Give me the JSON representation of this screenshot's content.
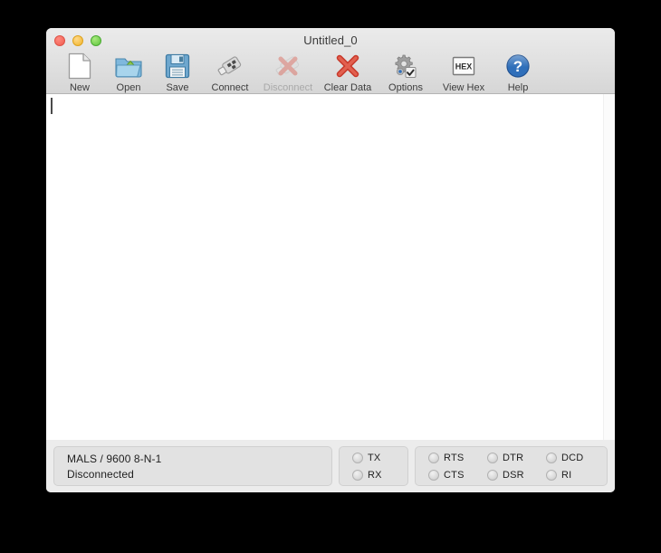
{
  "window": {
    "title": "Untitled_0",
    "traffic_lights": [
      {
        "name": "close",
        "color": "#f05c4e"
      },
      {
        "name": "minimize",
        "color": "#f0b428"
      },
      {
        "name": "zoom",
        "color": "#5cc33c"
      }
    ]
  },
  "toolbar": {
    "items": [
      {
        "label": "New",
        "icon": "new-document-icon",
        "enabled": true
      },
      {
        "label": "Open",
        "icon": "open-folder-icon",
        "enabled": true
      },
      {
        "label": "Save",
        "icon": "floppy-disk-icon",
        "enabled": true
      },
      {
        "label": "Connect",
        "icon": "usb-plug-icon",
        "enabled": true
      },
      {
        "label": "Disconnect",
        "icon": "red-x-icon",
        "enabled": false
      },
      {
        "label": "Clear Data",
        "icon": "red-x-bold-icon",
        "enabled": true
      },
      {
        "label": "Options",
        "icon": "gears-icon",
        "enabled": true
      },
      {
        "label": "View Hex",
        "icon": "hex-box-icon",
        "enabled": true
      },
      {
        "label": "Help",
        "icon": "question-mark-icon",
        "enabled": true
      }
    ],
    "hex_icon_text": "HEX"
  },
  "content": {
    "text": "",
    "caret_visible": true
  },
  "statusbar": {
    "line1": "MALS / 9600 8-N-1",
    "line2": "Disconnected",
    "signal_group_1": [
      {
        "label": "TX",
        "on": false
      },
      {
        "label": "RX",
        "on": false
      }
    ],
    "signal_group_2": [
      {
        "label": "RTS",
        "on": false
      },
      {
        "label": "CTS",
        "on": false
      },
      {
        "label": "DTR",
        "on": false
      },
      {
        "label": "DSR",
        "on": false
      },
      {
        "label": "DCD",
        "on": false
      },
      {
        "label": "RI",
        "on": false
      }
    ]
  },
  "colors": {
    "desktop_background": "#000000",
    "window_chrome": "#ececec",
    "toolbar_top": "#ebebeb",
    "toolbar_bottom": "#d6d6d6",
    "content_background": "#ffffff",
    "status_panel": "#e2e2e2",
    "disabled_text": "#a9a9a9",
    "body_text": "#1f1f1f"
  }
}
